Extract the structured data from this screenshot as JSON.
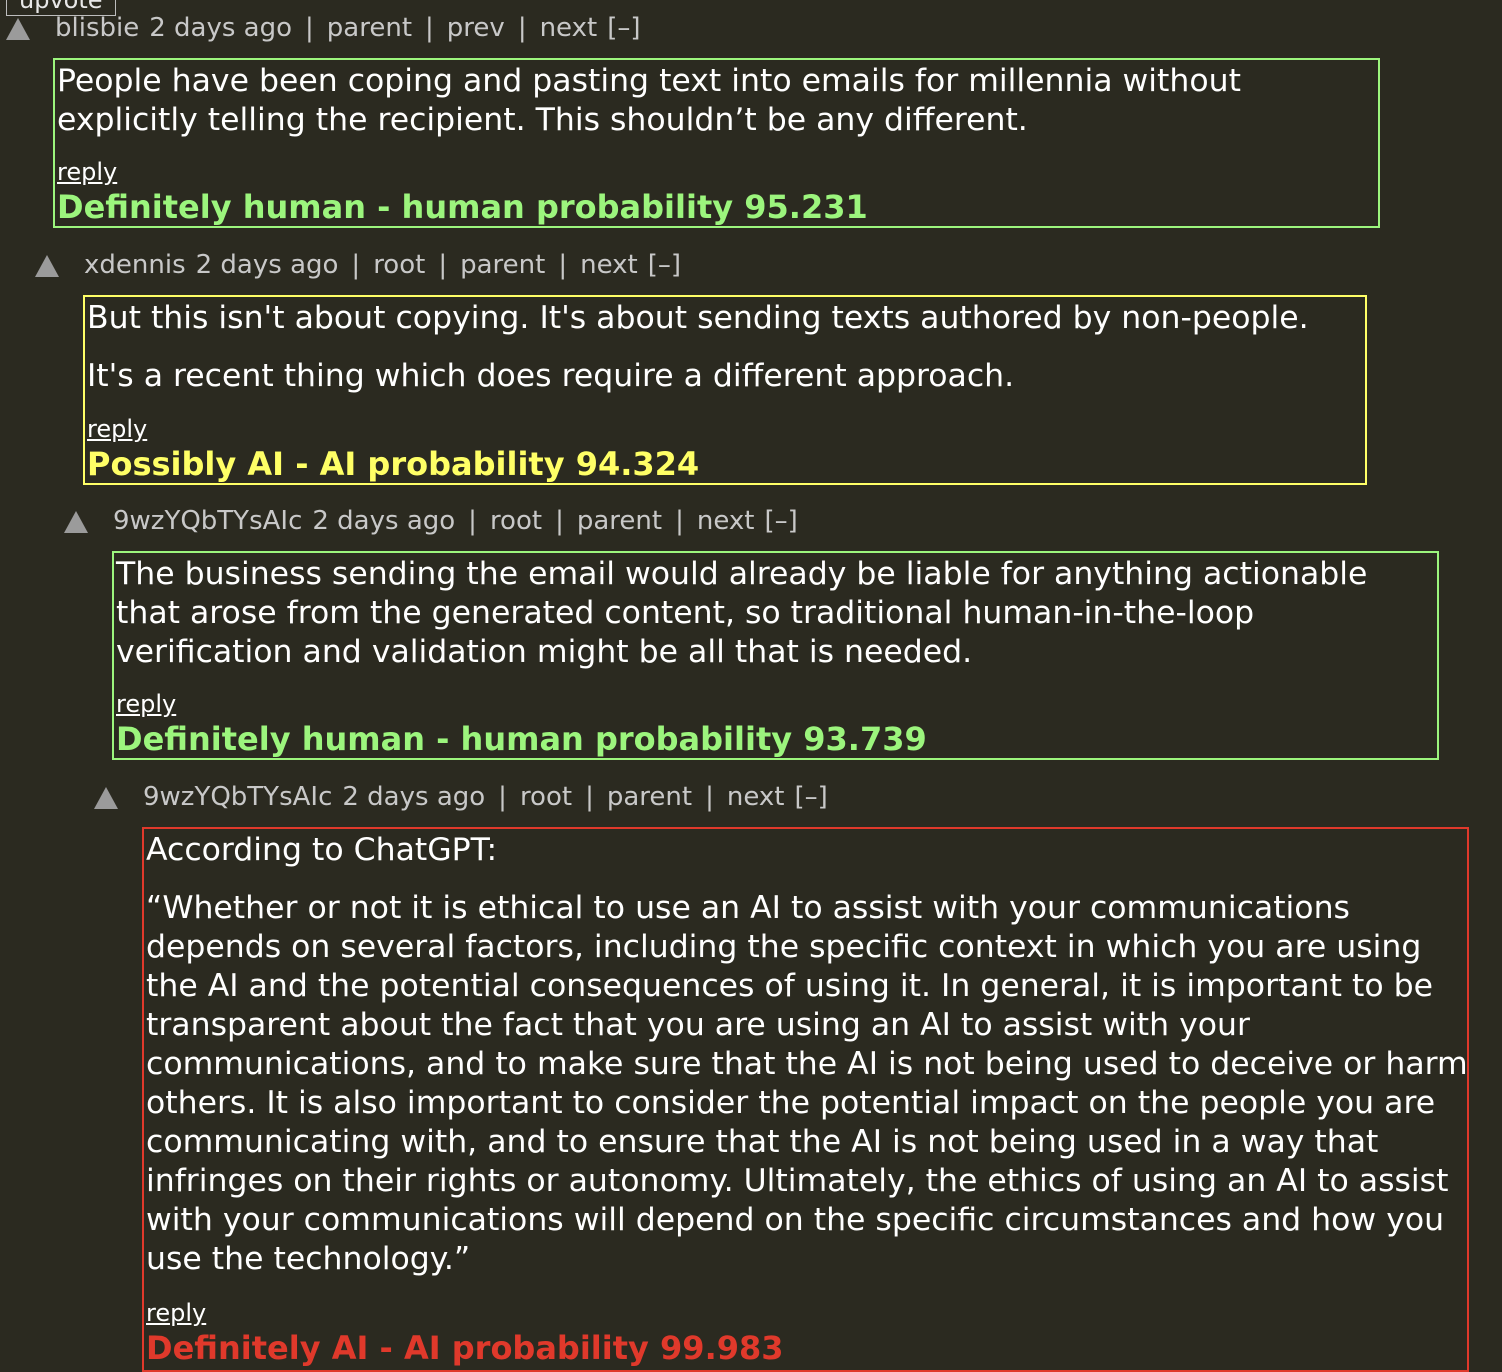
{
  "tooltip": "upvote",
  "comments": [
    {
      "user": "blisbie",
      "age": "2 days ago",
      "links": [
        "parent",
        "prev",
        "next"
      ],
      "toggle": "[–]",
      "paragraphs": [
        "People have been coping and pasting text into emails for millennia without explicitly telling the recipient. This shouldn’t be any different."
      ],
      "reply": "reply",
      "verdict": "Definitely human - human probability 95.231",
      "verdict_class": "human"
    },
    {
      "user": "xdennis",
      "age": "2 days ago",
      "links": [
        "root",
        "parent",
        "next"
      ],
      "toggle": "[–]",
      "paragraphs": [
        "But this isn't about copying. It's about sending texts authored by non-people.",
        "It's a recent thing which does require a different approach."
      ],
      "reply": "reply",
      "verdict": "Possibly AI - AI probability 94.324",
      "verdict_class": "possible"
    },
    {
      "user": "9wzYQbTYsAIc",
      "age": "2 days ago",
      "links": [
        "root",
        "parent",
        "next"
      ],
      "toggle": "[–]",
      "paragraphs": [
        "The business sending the email would already be liable for anything actionable that arose from the generated content, so traditional human-in-the-loop verification and validation might be all that is needed."
      ],
      "reply": "reply",
      "verdict": "Definitely human - human probability 93.739",
      "verdict_class": "human"
    },
    {
      "user": "9wzYQbTYsAIc",
      "age": "2 days ago",
      "links": [
        "root",
        "parent",
        "next"
      ],
      "toggle": "[–]",
      "paragraphs": [
        "According to ChatGPT:",
        "“Whether or not it is ethical to use an AI to assist with your communications depends on several factors, including the specific context in which you are using the AI and the potential consequences of using it. In general, it is important to be transparent about the fact that you are using an AI to assist with your communications, and to make sure that the AI is not being used to deceive or harm others. It is also important to consider the potential impact on the people you are communicating with, and to ensure that the AI is not being used in a way that infringes on their rights or autonomy. Ultimately, the ethics of using an AI to assist with your communications will depend on the specific circumstances and how you use the technology.”"
      ],
      "reply": "reply",
      "verdict": "Definitely AI - AI probability 99.983",
      "verdict_class": "ai"
    }
  ]
}
